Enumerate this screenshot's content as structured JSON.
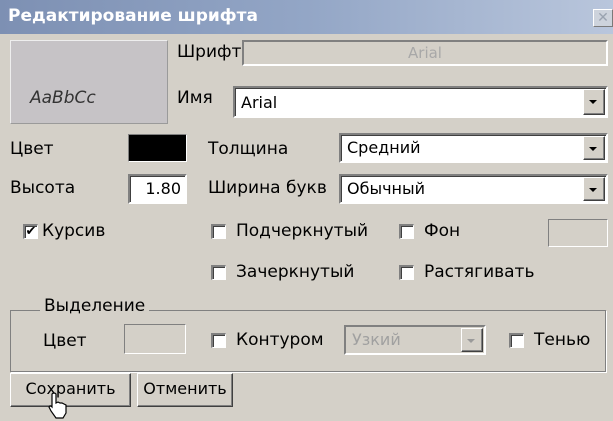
{
  "window": {
    "title": "Редактирование шрифта",
    "close_glyph": "✕"
  },
  "preview": {
    "sample_text": "AaBbCc"
  },
  "font": {
    "label": "Шрифт",
    "value": "Arial"
  },
  "name": {
    "label": "Имя",
    "value": "Arial"
  },
  "color": {
    "label": "Цвет",
    "value_color": "#000000"
  },
  "thickness": {
    "label": "Толщина",
    "value": "Средний"
  },
  "height": {
    "label": "Высота",
    "value": "1.80"
  },
  "letter_width": {
    "label": "Ширина букв",
    "value": "Обычный"
  },
  "checkboxes": {
    "italic": {
      "label": "Курсив",
      "checked": true
    },
    "underline": {
      "label": "Подчеркнутый",
      "checked": false
    },
    "background": {
      "label": "Фон",
      "checked": false
    },
    "strikeout": {
      "label": "Зачеркнутый",
      "checked": false
    },
    "stretch": {
      "label": "Растягивать",
      "checked": false
    }
  },
  "background_color": "#d4d0c8",
  "selection": {
    "legend": "Выделение",
    "color_label": "Цвет",
    "color_value": "#d4d0c8",
    "outline": {
      "label": "Контуром",
      "checked": false
    },
    "outline_width": {
      "value": "Узкий"
    },
    "shadow": {
      "label": "Тенью",
      "checked": false
    }
  },
  "buttons": {
    "save": "Сохранить",
    "cancel": "Отменить"
  },
  "check_glyph": "✔"
}
